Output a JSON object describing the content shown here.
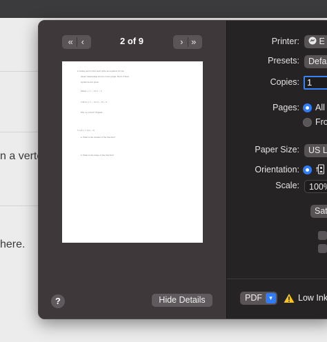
{
  "background": {
    "text1": "n a verte",
    "text2": "here."
  },
  "preview": {
    "page_indicator": "2 of 9",
    "first_page_glyph": "«",
    "prev_page_glyph": "‹",
    "next_page_glyph": "›",
    "last_page_glyph": "»",
    "paper_lines": [
      "4. Kelsey and Colton each write an equation for the",
      "linear relationship shown on the graph. Each of their",
      "equations are given.",
      "Kelsey:  y = − 1/2 x − 2",
      "Colton:  y = − 1/2 (x − 8) − 6",
      "Who is correct? Explain.",
      "5.  Let  y = 1/(x − 5)",
      "a. What is the domain of the function?",
      "b. What is the range of the function?"
    ]
  },
  "footer_left": {
    "help": "?",
    "hide_details": "Hide Details"
  },
  "settings": {
    "printer_label": "Printer:",
    "printer_value": "E",
    "presets_label": "Presets:",
    "presets_value": "Defa",
    "copies_label": "Copies:",
    "copies_value": "1",
    "pages_label": "Pages:",
    "pages_all": "All",
    "pages_from": "Fro",
    "paper_size_label": "Paper Size:",
    "paper_size_value": "US L",
    "orientation_label": "Orientation:",
    "orientation_value": "portrait",
    "scale_label": "Scale:",
    "scale_value": "100%",
    "section_button": "Sat"
  },
  "bottom": {
    "pdf_label": "PDF",
    "warning": "Low Ink."
  },
  "colors": {
    "accent": "#2f7cf6",
    "warning": "#f7c51e"
  }
}
